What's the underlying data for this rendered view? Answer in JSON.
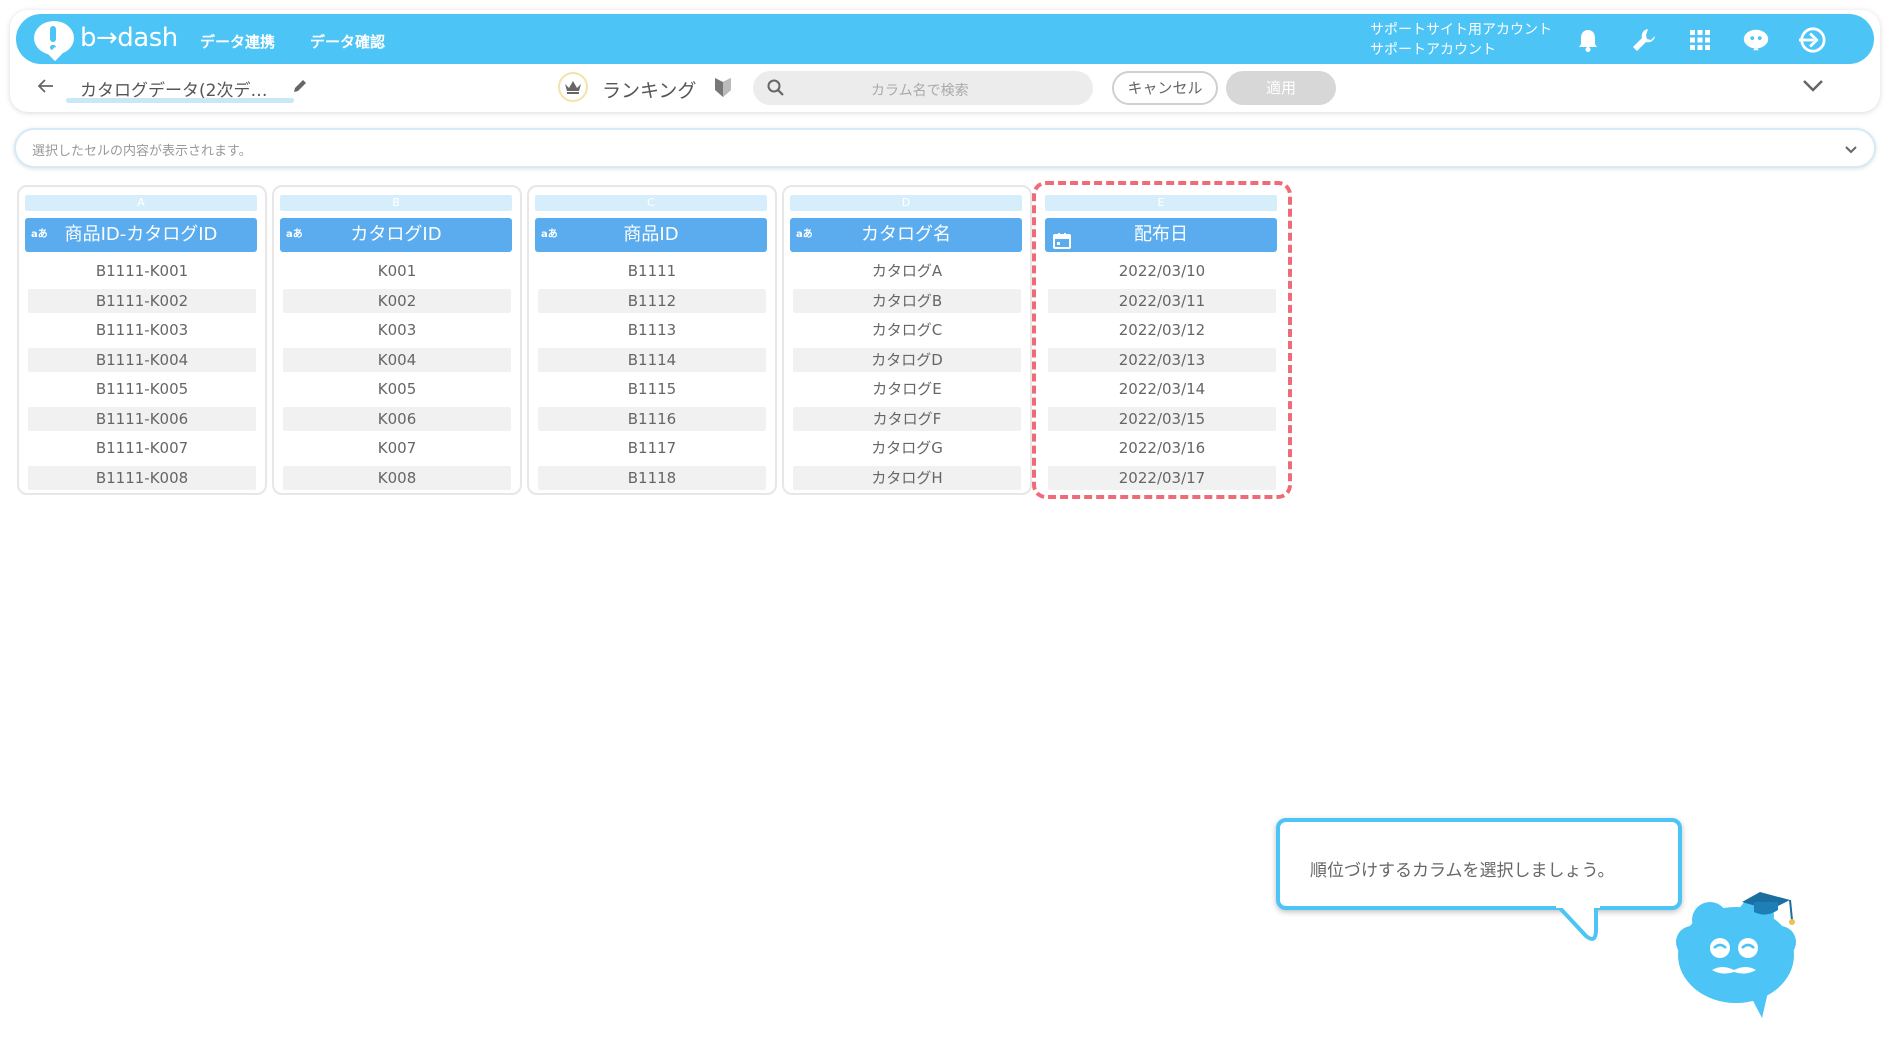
{
  "header": {
    "logo_text": "b→dash",
    "nav": [
      "データ連携",
      "データ確認"
    ],
    "account_line1": "サポートサイト用アカウント",
    "account_line2": "サポートアカウント",
    "brand_color": "#4cc4f5"
  },
  "subbar": {
    "title": "カタログデータ(2次デ…",
    "ranking_label": "ランキング",
    "search_placeholder": "カラム名で検索",
    "cancel_label": "キャンセル",
    "apply_label": "適用"
  },
  "cellbar": {
    "placeholder": "選択したセルの内容が表示されます。"
  },
  "columns": [
    {
      "letter": "A",
      "type_badge": "aあ",
      "header": "商品ID-カタログID",
      "cells": [
        "B1111-K001",
        "B1111-K002",
        "B1111-K003",
        "B1111-K004",
        "B1111-K005",
        "B1111-K006",
        "B1111-K007",
        "B1111-K008"
      ]
    },
    {
      "letter": "B",
      "type_badge": "aあ",
      "header": "カタログID",
      "cells": [
        "K001",
        "K002",
        "K003",
        "K004",
        "K005",
        "K006",
        "K007",
        "K008"
      ]
    },
    {
      "letter": "C",
      "type_badge": "aあ",
      "header": "商品ID",
      "cells": [
        "B1111",
        "B1112",
        "B1113",
        "B1114",
        "B1115",
        "B1116",
        "B1117",
        "B1118"
      ]
    },
    {
      "letter": "D",
      "type_badge": "aあ",
      "header": "カタログ名",
      "cells": [
        "カタログA",
        "カタログB",
        "カタログC",
        "カタログD",
        "カタログE",
        "カタログF",
        "カタログG",
        "カタログH"
      ]
    },
    {
      "letter": "E",
      "type_badge": "calendar-icon",
      "header": "配布日",
      "cells": [
        "2022/03/10",
        "2022/03/11",
        "2022/03/12",
        "2022/03/13",
        "2022/03/14",
        "2022/03/15",
        "2022/03/16",
        "2022/03/17"
      ]
    }
  ],
  "tooltip": {
    "text": "順位づけするカラムを選択しましょう。"
  },
  "colors": {
    "header_blue": "#5aacee",
    "highlight": "#ef6b78"
  }
}
